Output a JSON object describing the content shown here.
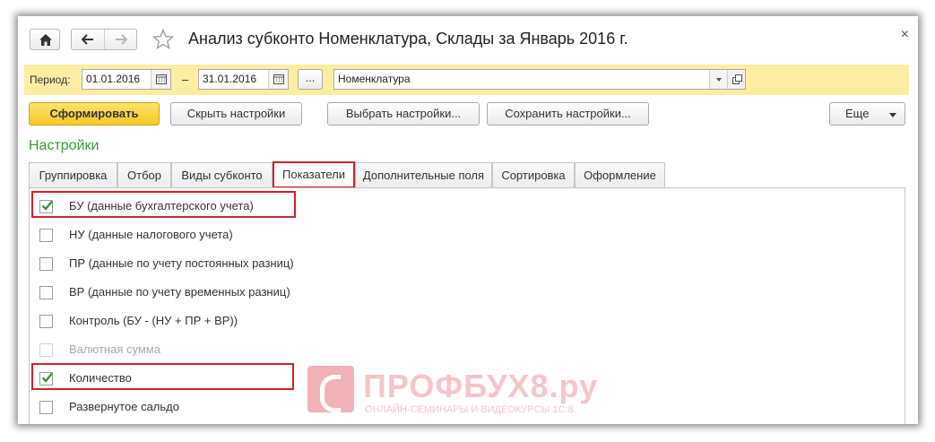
{
  "window": {
    "title": "Анализ субконто Номенклатура, Склады за Январь 2016 г.",
    "close_glyph": "×"
  },
  "period": {
    "label": "Период:",
    "from": "01.01.2016",
    "dash": "–",
    "to": "31.01.2016",
    "more_glyph": "...",
    "nomenclature_value": "Номенклатура"
  },
  "toolbar": {
    "generate": "Сформировать",
    "hide_settings": "Скрыть настройки",
    "choose_settings": "Выбрать настройки...",
    "save_settings": "Сохранить настройки...",
    "more": "Еще"
  },
  "settings": {
    "title": "Настройки",
    "tabs": [
      {
        "label": "Группировка",
        "active": false
      },
      {
        "label": "Отбор",
        "active": false
      },
      {
        "label": "Виды субконто",
        "active": false
      },
      {
        "label": "Показатели",
        "active": true
      },
      {
        "label": "Дополнительные поля",
        "active": false
      },
      {
        "label": "Сортировка",
        "active": false
      },
      {
        "label": "Оформление",
        "active": false
      }
    ],
    "indicators": [
      {
        "label": "БУ (данные бухгалтерского учета)",
        "checked": true,
        "enabled": true
      },
      {
        "label": "НУ (данные налогового учета)",
        "checked": false,
        "enabled": true
      },
      {
        "label": "ПР (данные по учету постоянных разниц)",
        "checked": false,
        "enabled": true
      },
      {
        "label": "ВР (данные по учету временных разниц)",
        "checked": false,
        "enabled": true
      },
      {
        "label": "Контроль (БУ - (НУ + ПР + ВР))",
        "checked": false,
        "enabled": true
      },
      {
        "label": "Валютная сумма",
        "checked": false,
        "enabled": false
      },
      {
        "label": "Количество",
        "checked": true,
        "enabled": true
      },
      {
        "label": "Развернутое сальдо",
        "checked": false,
        "enabled": true
      }
    ]
  },
  "watermark": {
    "brand": "ПРОФБУХ8.ру",
    "subtitle": "ОНЛАЙН-СЕМИНАРЫ И ВИДЕОКУРСЫ 1С:8"
  },
  "colors": {
    "accent_yellow": "#fbeda1",
    "primary_button": "#f3c726",
    "settings_green": "#3a9a3a",
    "highlight_red": "#d0202a",
    "check_green": "#2e9a3a"
  },
  "icons": [
    "home-icon",
    "back-arrow-icon",
    "forward-arrow-icon",
    "favorite-star-icon",
    "close-icon",
    "calendar-icon",
    "dropdown-icon",
    "open-icon",
    "checkmark-icon"
  ]
}
